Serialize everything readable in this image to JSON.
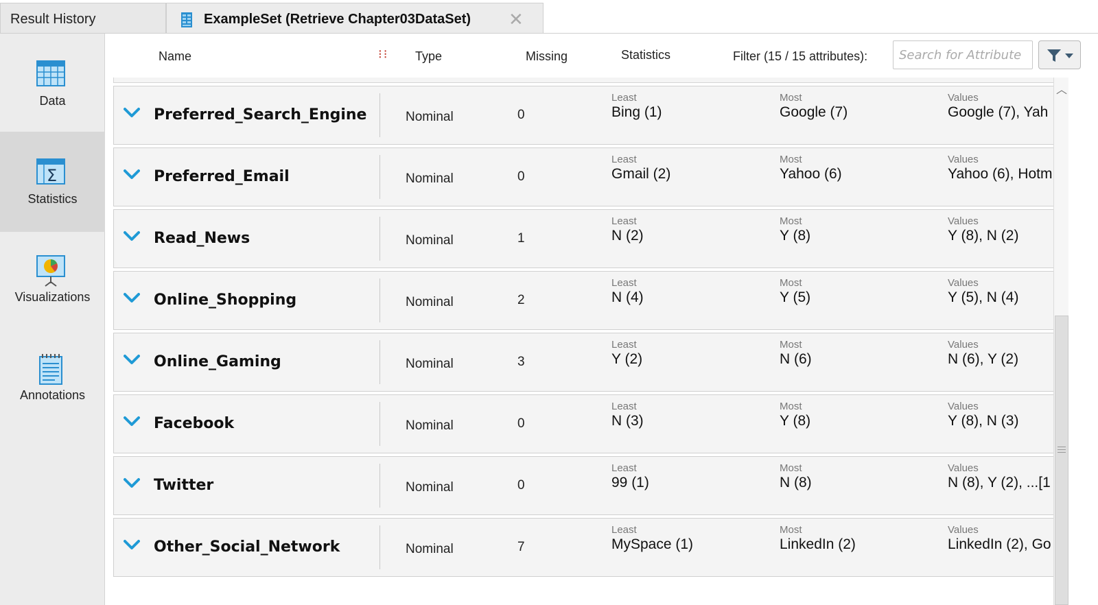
{
  "tabs": {
    "history_label": "Result History",
    "active_label": "ExampleSet (Retrieve Chapter03DataSet)",
    "close_symbol": "✕"
  },
  "sidebar": {
    "items": [
      {
        "label": "Data",
        "icon": "table-icon"
      },
      {
        "label": "Statistics",
        "icon": "sigma-table-icon",
        "selected": true
      },
      {
        "label": "Visualizations",
        "icon": "chart-board-icon"
      },
      {
        "label": "Annotations",
        "icon": "notepad-icon"
      }
    ]
  },
  "header": {
    "name": "Name",
    "resize_glyph": "⁝⁝",
    "type": "Type",
    "missing": "Missing",
    "statistics": "Statistics",
    "filter": "Filter (15 / 15 attributes):",
    "search_placeholder": "Search for Attribute"
  },
  "captions": {
    "least": "Least",
    "most": "Most",
    "values": "Values"
  },
  "rows": [
    {
      "name": "Preferred_Search_Engine",
      "type": "Nominal",
      "missing": "0",
      "least": "Bing (1)",
      "most": "Google (7)",
      "values": "Google (7), Yah"
    },
    {
      "name": "Preferred_Email",
      "type": "Nominal",
      "missing": "0",
      "least": "Gmail (2)",
      "most": "Yahoo (6)",
      "values": "Yahoo (6), Hotm"
    },
    {
      "name": "Read_News",
      "type": "Nominal",
      "missing": "1",
      "least": "N (2)",
      "most": "Y (8)",
      "values": "Y (8), N (2)"
    },
    {
      "name": "Online_Shopping",
      "type": "Nominal",
      "missing": "2",
      "least": "N (4)",
      "most": "Y (5)",
      "values": "Y (5), N (4)"
    },
    {
      "name": "Online_Gaming",
      "type": "Nominal",
      "missing": "3",
      "least": "Y (2)",
      "most": "N (6)",
      "values": "N (6), Y (2)"
    },
    {
      "name": "Facebook",
      "type": "Nominal",
      "missing": "0",
      "least": "N (3)",
      "most": "Y (8)",
      "values": "Y (8), N (3)"
    },
    {
      "name": "Twitter",
      "type": "Nominal",
      "missing": "0",
      "least": "99 (1)",
      "most": "N (8)",
      "values": "N (8), Y (2), ...[1"
    },
    {
      "name": "Other_Social_Network",
      "type": "Nominal",
      "missing": "7",
      "least": "MySpace (1)",
      "most": "LinkedIn (2)",
      "values": "LinkedIn (2), Go"
    }
  ],
  "colors": {
    "accent": "#1f9ad6",
    "sidebar_bg": "#ececec",
    "row_bg": "#f4f4f4"
  }
}
